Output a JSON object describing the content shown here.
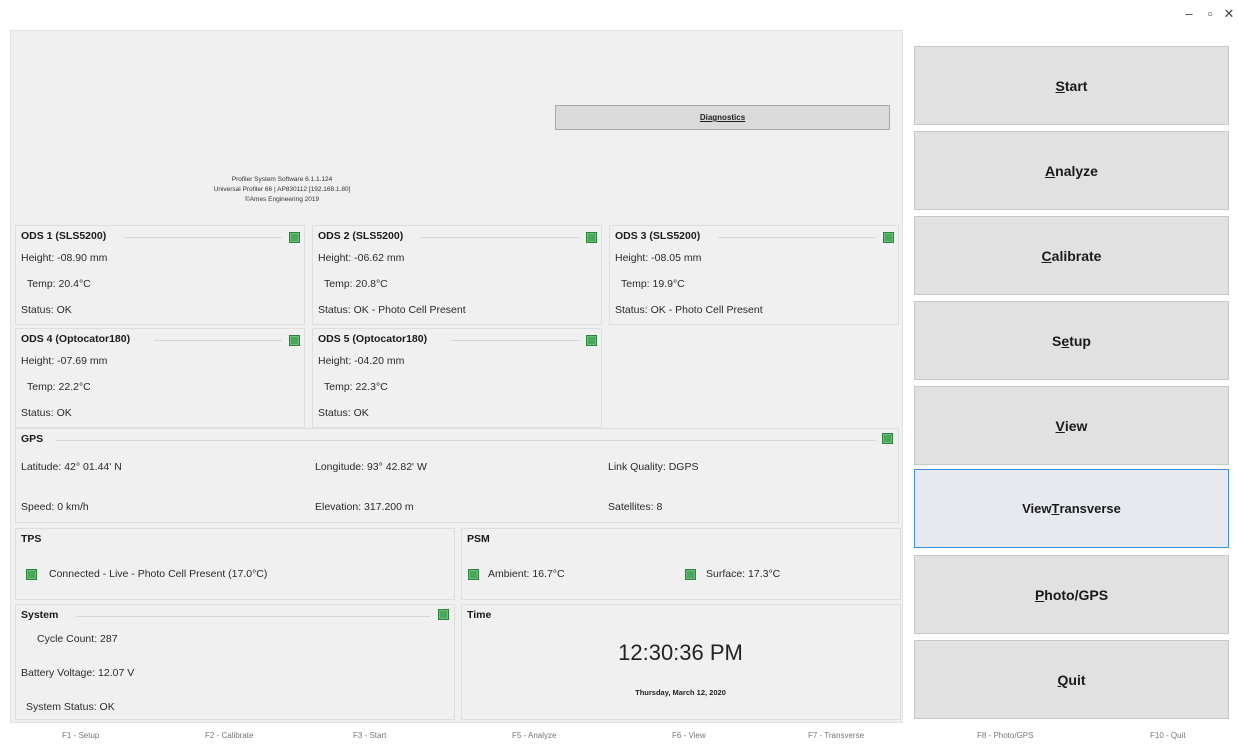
{
  "window": {
    "minimize": "–",
    "restore": "▫",
    "close": "✕"
  },
  "diagnostics": {
    "label": "Diagnostics"
  },
  "about": {
    "line1": "Profiler System Software 6.1.1.124",
    "line2": "Universal Profiler 66 | AP830112 [192.168.1.80]",
    "line3": "©Ames Engineering 2019"
  },
  "ods": [
    {
      "title": "ODS 1 (SLS5200)",
      "height": "Height:  -08.90 mm",
      "temp": "Temp:  20.4°C",
      "status": "Status:  OK"
    },
    {
      "title": "ODS 2 (SLS5200)",
      "height": "Height:  -06.62 mm",
      "temp": "Temp:  20.8°C",
      "status": "Status:  OK - Photo Cell Present"
    },
    {
      "title": "ODS 3 (SLS5200)",
      "height": "Height:  -08.05 mm",
      "temp": "Temp:  19.9°C",
      "status": "Status:  OK - Photo Cell Present"
    },
    {
      "title": "ODS 4 (Optocator180)",
      "height": "Height:  -07.69 mm",
      "temp": "Temp:  22.2°C",
      "status": "Status:  OK"
    },
    {
      "title": "ODS 5 (Optocator180)",
      "height": "Height:  -04.20 mm",
      "temp": "Temp:  22.3°C",
      "status": "Status:  OK"
    }
  ],
  "gps": {
    "title": "GPS",
    "latitude": "Latitude: 42° 01.44' N",
    "longitude": "Longitude: 93° 42.82' W",
    "link_quality": "Link Quality: DGPS",
    "speed": "Speed: 0 km/h",
    "elevation": "Elevation: 317.200 m",
    "satellites": "Satellites: 8"
  },
  "tps": {
    "title": "TPS",
    "status": "Connected - Live  - Photo Cell Present (17.0°C)"
  },
  "psm": {
    "title": "PSM",
    "ambient": "Ambient: 16.7°C",
    "surface": "Surface: 17.3°C"
  },
  "system": {
    "title": "System",
    "cycle_count": "Cycle Count:  287",
    "battery_voltage": "Battery Voltage:  12.07 V",
    "system_status": "System Status:  OK"
  },
  "time": {
    "title": "Time",
    "clock": "12:30:36 PM",
    "date": "Thursday, March 12, 2020"
  },
  "side_buttons": [
    {
      "pre": "",
      "key": "S",
      "post": "tart"
    },
    {
      "pre": "",
      "key": "A",
      "post": "nalyze"
    },
    {
      "pre": "",
      "key": "C",
      "post": "alibrate"
    },
    {
      "pre": "S",
      "key": "e",
      "post": "tup"
    },
    {
      "pre": "",
      "key": "V",
      "post": "iew"
    },
    {
      "pre": "View ",
      "key": "T",
      "post": "ransverse"
    },
    {
      "pre": "",
      "key": "P",
      "post": "hoto/GPS"
    },
    {
      "pre": "",
      "key": "Q",
      "post": "uit"
    }
  ],
  "function_keys": [
    "F1 - Setup",
    "F2 - Calibrate",
    "F3 - Start",
    "F5 - Analyze",
    "F6 - View",
    "F7 - Transverse",
    "F8 - Photo/GPS",
    "F10 - Quit"
  ],
  "colors": {
    "led_ok": "#48a85a",
    "active_border": "#3d8ee0",
    "panel_bg": "#f0f0f0"
  }
}
